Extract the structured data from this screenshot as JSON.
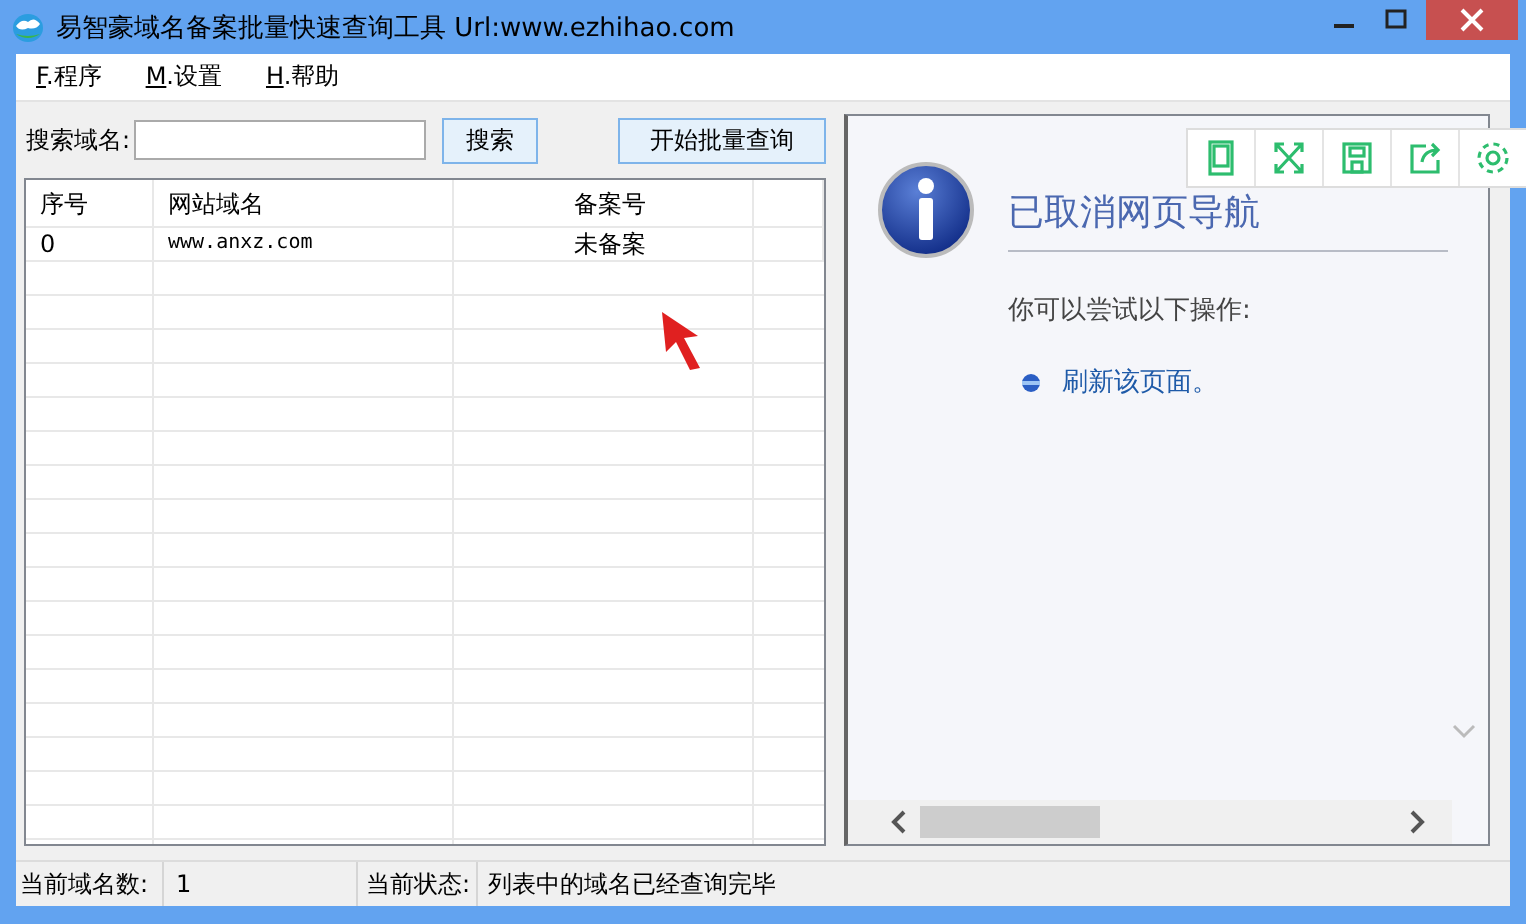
{
  "window": {
    "title": "易智豪域名备案批量快速查询工具 Url:www.ezhihao.com"
  },
  "menu": [
    {
      "mnemonic": "F",
      "label": ".程序"
    },
    {
      "mnemonic": "M",
      "label": ".设置"
    },
    {
      "mnemonic": "H",
      "label": ".帮助"
    }
  ],
  "search": {
    "label": "搜索域名:"
  },
  "buttons": [
    "搜索",
    "开始批量查询"
  ],
  "table": {
    "columns": [
      "序号",
      "网站域名",
      "备案号"
    ],
    "rows": [
      [
        "0",
        "www.anxz.com",
        "未备案"
      ]
    ]
  },
  "browser": {
    "heading": "已取消网页导航",
    "prompt": "你可以尝试以下操作:",
    "links": [
      "刷新该页面。"
    ]
  },
  "status_bar": [
    {
      "label": "当前域名数:",
      "value": "1"
    },
    {
      "label": "当前状态:",
      "value": "列表中的域名已经查询完毕"
    }
  ]
}
